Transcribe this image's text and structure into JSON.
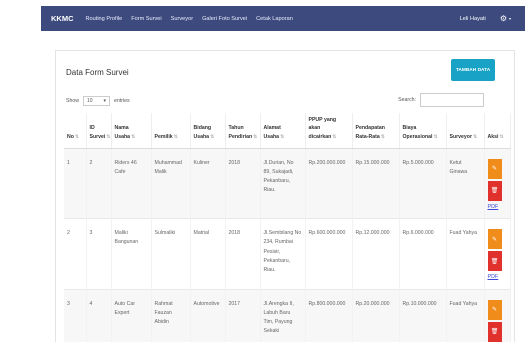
{
  "navbar": {
    "brand": "KKMC",
    "links": [
      "Routing Profile",
      "Form Survei",
      "Surveyor",
      "Galeri Foto Survei",
      "Cetak Laporan"
    ],
    "user_name": "Leli Hayati",
    "gear_glyph": "⚙",
    "caret_glyph": "▾"
  },
  "panel": {
    "title": "Data Form Survei",
    "add_button": "TAMBAH DATA",
    "show_label": "Show",
    "length_value": "10",
    "length_caret": "▾",
    "entries_label": "entries",
    "search_label": "Search:"
  },
  "table": {
    "sort_glyph": "⇅",
    "headers": [
      "No",
      "ID Survei",
      "Nama Usaha",
      "Pemilik",
      "Bidang Usaha",
      "Tahun Pendirian",
      "Alamat Usaha",
      "PPUP yang akan dicairkan",
      "Pendapatan Rata-Rata",
      "Biaya Operasional",
      "Surveyor",
      "Aksi"
    ],
    "rows": [
      {
        "no": "1",
        "id": "2",
        "nama": "Riders 46 Cafe",
        "pemilik": "Muhammad Malik",
        "bidang": "Kuliner",
        "tahun": "2018",
        "alamat": "Jl.Durian, No 89, Sukajadi, Pekanbaru, Riau.",
        "ppup": "Rp.200.000.000",
        "pendapatan": "Rp.15.000.000",
        "biaya": "Rp.5.000.000",
        "surveyor": "Ketut Ginawa",
        "edit_glyph": "✎",
        "delete_glyph": "🗑",
        "pdf": "PDF"
      },
      {
        "no": "2",
        "id": "3",
        "nama": "Maliki Bangunan",
        "pemilik": "Sulmaliki",
        "bidang": "Matrial",
        "tahun": "2018",
        "alamat": "Jl.Sembilang No 234, Rumbai Pesisir, Pekanbaru, Riau.",
        "ppup": "Rp.600.000.000",
        "pendapatan": "Rp.12.000.000",
        "biaya": "Rp.6.000.000",
        "surveyor": "Fuad Yahya",
        "edit_glyph": "✎",
        "delete_glyph": "🗑",
        "pdf": "PDF"
      },
      {
        "no": "3",
        "id": "4",
        "nama": "Auto Car Expert",
        "pemilik": "Rahmat Fauzan Abidin",
        "bidang": "Automotive",
        "tahun": "2017",
        "alamat": "Jl.Arengka II, Labuh Baru Tim, Payung Sekaki",
        "ppup": "Rp.800.000.000",
        "pendapatan": "Rp.20.000.000",
        "biaya": "Rp.10.000.000",
        "surveyor": "Fuad Yahya",
        "edit_glyph": "✎",
        "delete_glyph": "🗑",
        "pdf": ""
      }
    ]
  },
  "colors": {
    "navbar_bg": "#3c4a7e",
    "add_button_bg": "#17a2c6",
    "edit_button_bg": "#f08c1a",
    "delete_button_bg": "#e0312d",
    "pdf_link": "#3b4bd9"
  }
}
